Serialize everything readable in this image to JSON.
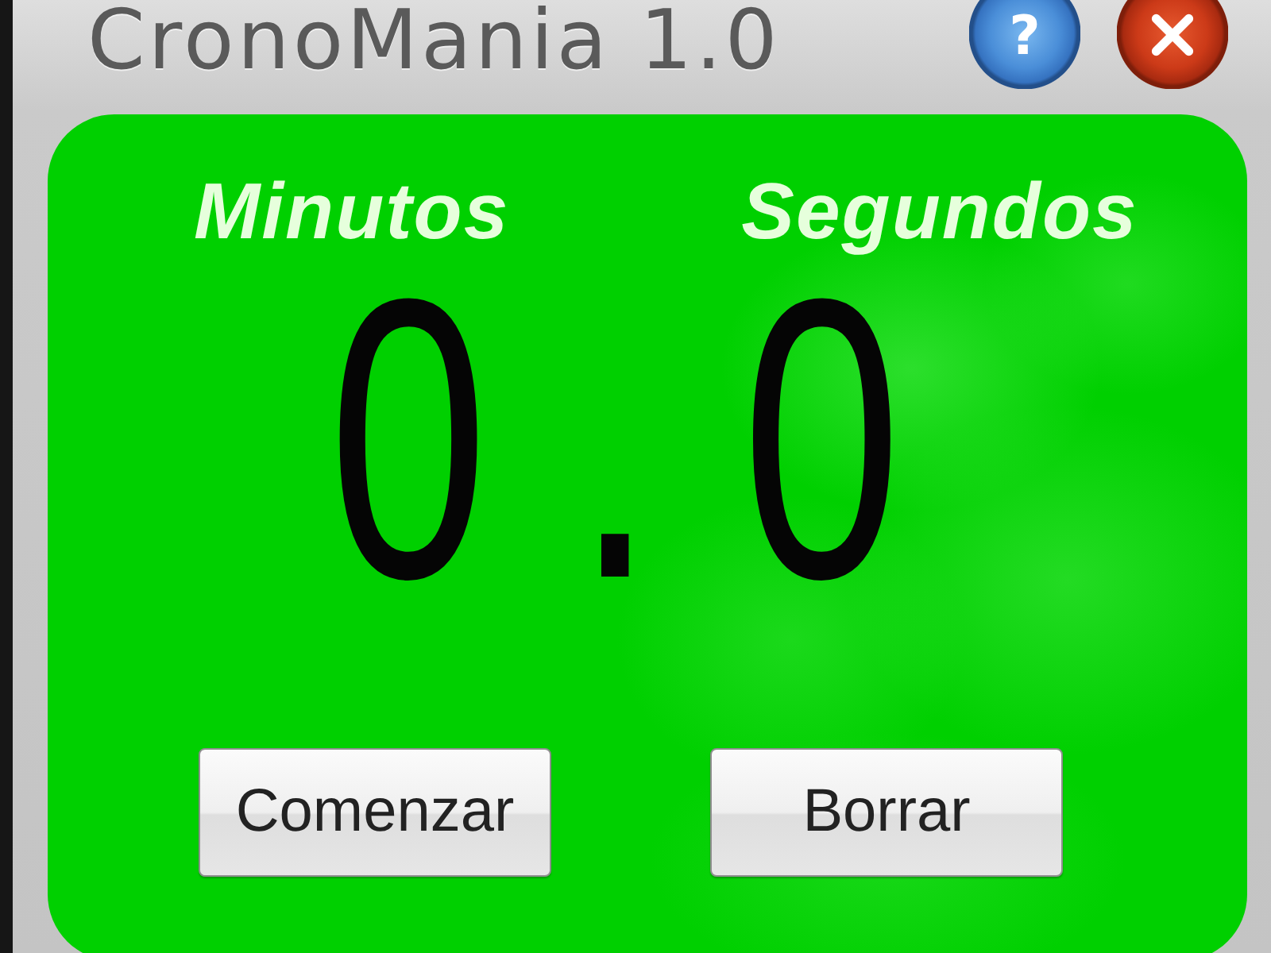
{
  "window": {
    "title": "CronoMania 1.0",
    "title_buttons": [
      {
        "kind": "help",
        "label": "?"
      },
      {
        "kind": "close"
      }
    ]
  },
  "timer": {
    "labels": [
      "Minutos",
      "Segundos"
    ],
    "display": "0.0"
  },
  "buttons": [
    "Comenzar",
    "Borrar"
  ]
}
